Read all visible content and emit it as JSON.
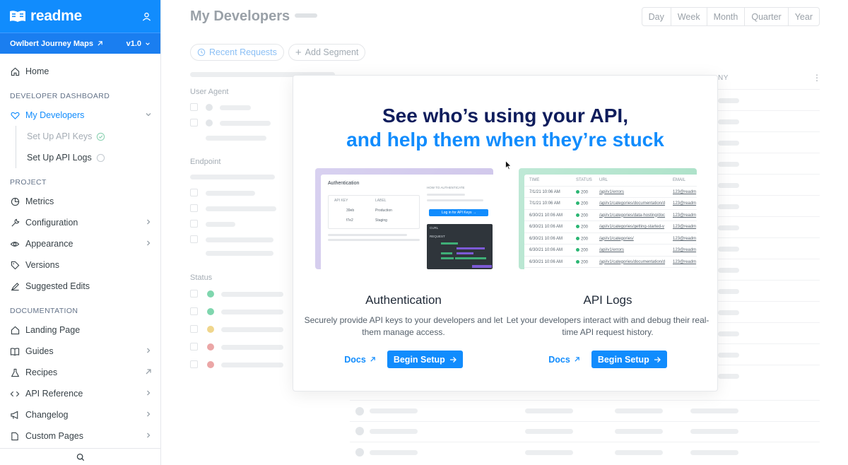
{
  "brand": {
    "name": "readme"
  },
  "project": {
    "name": "Owlbert Journey Maps",
    "version": "v1.0"
  },
  "sidebar": {
    "home": "Home",
    "developer_dashboard_label": "DEVELOPER DASHBOARD",
    "my_developers": "My Developers",
    "sub": [
      {
        "label": "Set Up API Keys"
      },
      {
        "label": "Set Up API Logs"
      }
    ],
    "project_label": "PROJECT",
    "project_items": [
      "Metrics",
      "Configuration",
      "Appearance",
      "Versions",
      "Suggested Edits"
    ],
    "documentation_label": "DOCUMENTATION",
    "doc_items": [
      "Landing Page",
      "Guides",
      "Recipes",
      "API Reference",
      "Changelog",
      "Custom Pages"
    ]
  },
  "main": {
    "title": "My Developers",
    "ranges": [
      "Day",
      "Week",
      "Month",
      "Quarter",
      "Year"
    ],
    "recent_requests": "Recent Requests",
    "add_segment": "Add Segment",
    "filters": {
      "user_agent": "User Agent",
      "endpoint": "Endpoint",
      "status": "Status"
    },
    "column_partial": "NY",
    "status_colors": [
      "#7fd6ae",
      "#7fd6ae",
      "#f0d68c",
      "#eba6a6",
      "#eba6a6"
    ]
  },
  "modal": {
    "headline_1": "See who’s using your API,",
    "headline_2": "and help them when they’re stuck",
    "auth": {
      "title": "Authentication",
      "desc": "Securely provide API keys to your developers and let them manage access.",
      "docs": "Docs",
      "setup": "Begin Setup",
      "mini": {
        "heading": "Authentication",
        "col_key": "API KEY",
        "col_label": "LABEL",
        "how_to": "HOW TO AUTHENTICATE",
        "key_1": "39eb",
        "key_2": "f7e2",
        "label_1": "Production",
        "label_2": "Staging",
        "login_btn": "Log in for API Keys →",
        "curl": "CURL",
        "request": "REQUEST"
      }
    },
    "logs": {
      "title": "API Logs",
      "desc": "Let your developers interact with and debug their real-time API request history.",
      "docs": "Docs",
      "setup": "Begin Setup",
      "headers": [
        "TIME",
        "STATUS",
        "URL",
        "EMAIL"
      ],
      "rows": [
        {
          "time": "7/1/21 10:06 AM",
          "status": "200",
          "url": "/api/v1/errors",
          "email": "123@readm"
        },
        {
          "time": "7/1/21 10:06 AM",
          "status": "200",
          "url": "/api/v1/categories/documentation/d",
          "email": "123@readm"
        },
        {
          "time": "6/30/21 10:06 AM",
          "status": "200",
          "url": "/api/v1/categories/data-hosting/doc",
          "email": "123@readm"
        },
        {
          "time": "6/30/21 10:06 AM",
          "status": "200",
          "url": "/api/v1/categories/getting-started-v",
          "email": "123@readm"
        },
        {
          "time": "6/30/21 10:06 AM",
          "status": "200",
          "url": "/api/v1/categories/",
          "email": "123@readm"
        },
        {
          "time": "6/30/21 10:06 AM",
          "status": "200",
          "url": "/api/v1/errors",
          "email": "123@readm"
        },
        {
          "time": "6/30/21 10:06 AM",
          "status": "200",
          "url": "/api/v1/categories/documentation/d",
          "email": "123@readm"
        }
      ]
    }
  }
}
